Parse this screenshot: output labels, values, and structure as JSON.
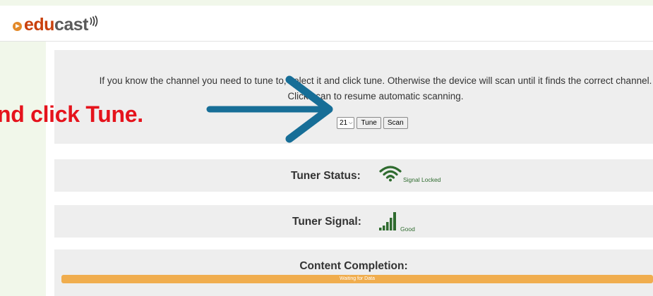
{
  "logo": {
    "part1": "edu",
    "part2": "cast"
  },
  "intro": {
    "text": "If you know the channel you need to tune to, select it and click tune. Otherwise the device will scan until it finds the correct channel. Click scan to resume automatic scanning."
  },
  "controls": {
    "channel_value": "21",
    "tune_label": "Tune",
    "scan_label": "Scan"
  },
  "tuner_status": {
    "label": "Tuner Status:",
    "value": "Signal Locked",
    "icon": "wifi-icon"
  },
  "tuner_signal": {
    "label": "Tuner Signal:",
    "value": "Good",
    "icon": "signal-bars-icon"
  },
  "content_completion": {
    "label": "Content Completion:",
    "status": "Waiting for Data",
    "progress_fraction": 1.0
  },
  "overlay": {
    "text": "nd click Tune."
  },
  "colors": {
    "background": "#f1f7ea",
    "brand_orange": "#c9400c",
    "signal_green": "#2f6b2f",
    "progress": "#f0ad4e",
    "overlay_red": "#e5131c",
    "arrow_blue": "#176e97"
  }
}
